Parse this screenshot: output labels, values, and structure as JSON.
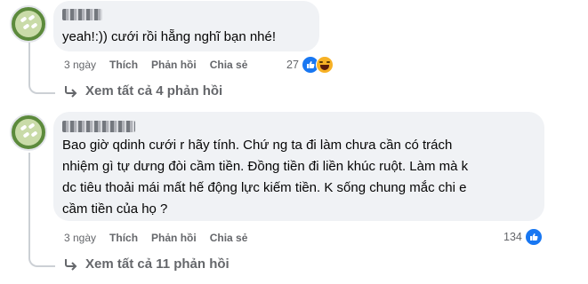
{
  "comments": [
    {
      "text": "yeah!:)) cưới rồi hẵng nghĩ bạn nhé!",
      "time": "3 ngày",
      "like_label": "Thích",
      "reply_label": "Phản hồi",
      "share_label": "Chia sẻ",
      "reaction_count": "27",
      "reactions": [
        "like-icon",
        "haha-icon"
      ],
      "view_replies": "Xem tất cả 4 phản hồi"
    },
    {
      "text": "Bao giờ qdinh cưới r hãy tính. Chứ ng ta đi làm chưa cần có trách\nnhiệm gì tự dưng đòi cầm tiền. Đồng tiền đi liền khúc ruột. Làm mà k\ndc tiêu thoải mái mất hế động lực kiếm tiền. K sống chung mắc chi e\ncầm tiền của họ ?",
      "time": "3 ngày",
      "like_label": "Thích",
      "reply_label": "Phản hồi",
      "share_label": "Chia sẻ",
      "reaction_count": "134",
      "reactions": [
        "like-icon"
      ],
      "view_replies": "Xem tất cả 11 phản hồi"
    }
  ],
  "colors": {
    "bubble": "#f0f2f5",
    "meta_text": "#65676b",
    "like_blue": "#1877f2",
    "haha_yellow": "#f7b125"
  }
}
